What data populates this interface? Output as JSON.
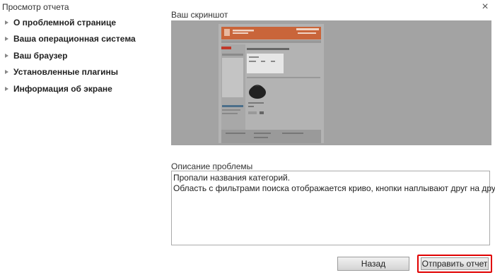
{
  "window": {
    "title": "Просмотр отчета"
  },
  "icons": {
    "close": "close-icon",
    "nav_marker": "triangle-right-icon"
  },
  "sidebar": {
    "items": [
      {
        "label": "О проблемной странице"
      },
      {
        "label": "Ваша операционная система"
      },
      {
        "label": "Ваш браузер"
      },
      {
        "label": "Установленные плагины"
      },
      {
        "label": "Информация об экране"
      }
    ]
  },
  "screenshot": {
    "label": "Ваш скриншот"
  },
  "description": {
    "label": "Описание проблемы",
    "lines": [
      "Пропали названия категорий.",
      "Область с фильтрами поиска отображается криво, кнопки наплывают друг на друга."
    ]
  },
  "buttons": {
    "back": "Назад",
    "send": "Отправить отчет"
  },
  "colors": {
    "highlight": "#e00000",
    "screenshot_bg": "#a3a3a3",
    "site_header": "#c9653a"
  }
}
